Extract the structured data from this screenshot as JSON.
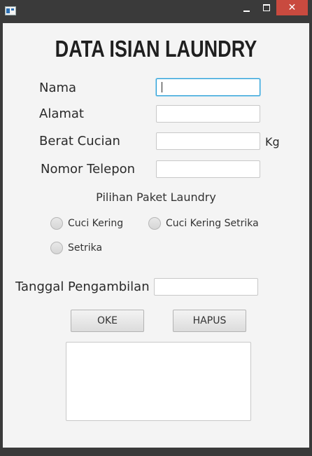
{
  "window": {
    "close_glyph": "✕"
  },
  "form": {
    "heading": "DATA ISIAN LAUNDRY",
    "nama_label": "Nama",
    "nama_value": "",
    "alamat_label": "Alamat",
    "alamat_value": "",
    "berat_label": "Berat Cucian",
    "berat_value": "",
    "berat_unit": "Kg",
    "telepon_label": "Nomor Telepon",
    "telepon_value": "",
    "paket_label": "Pilihan Paket Laundry",
    "paket_options": [
      "Cuci Kering",
      "Cuci Kering Setrika",
      "Setrika"
    ],
    "tanggal_label": "Tanggal Pengambilan",
    "tanggal_value": "",
    "oke_label": "OKE",
    "hapus_label": "HAPUS",
    "output_text": ""
  },
  "colors": {
    "focus_border": "#2a9fd6",
    "close_button": "#c94a3f",
    "client_bg": "#f4f4f4"
  }
}
